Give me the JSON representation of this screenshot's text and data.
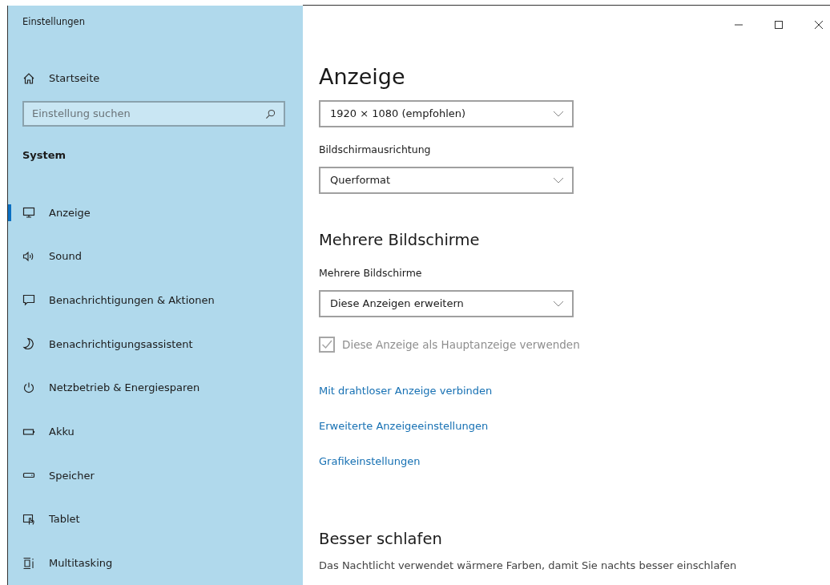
{
  "window": {
    "title": "Einstellungen"
  },
  "sidebar": {
    "home": "Startseite",
    "search": {
      "placeholder": "Einstellung suchen"
    },
    "section": "System",
    "items": [
      {
        "label": "Anzeige",
        "selected": true
      },
      {
        "label": "Sound",
        "selected": false
      },
      {
        "label": "Benachrichtigungen & Aktionen",
        "selected": false
      },
      {
        "label": "Benachrichtigungsassistent",
        "selected": false
      },
      {
        "label": "Netzbetrieb & Energiesparen",
        "selected": false
      },
      {
        "label": "Akku",
        "selected": false
      },
      {
        "label": "Speicher",
        "selected": false
      },
      {
        "label": "Tablet",
        "selected": false
      },
      {
        "label": "Multitasking",
        "selected": false
      }
    ]
  },
  "main": {
    "title": "Anzeige",
    "resolution": {
      "value": "1920 × 1080 (empfohlen)"
    },
    "orientation": {
      "label": "Bildschirmausrichtung",
      "value": "Querformat"
    },
    "multi_heading": "Mehrere Bildschirme",
    "multi": {
      "label": "Mehrere Bildschirme",
      "value": "Diese Anzeigen erweitern"
    },
    "main_display": {
      "label": "Diese Anzeige als Hauptanzeige verwenden",
      "checked": true,
      "disabled": true
    },
    "links": [
      "Mit drahtloser Anzeige verbinden",
      "Erweiterte Anzeigeeinstellungen",
      "Grafikeinstellungen"
    ],
    "sleep_heading": "Besser schlafen",
    "sleep_text": "Das Nachtlicht verwendet wärmere Farben, damit Sie nachts besser einschlafen"
  }
}
